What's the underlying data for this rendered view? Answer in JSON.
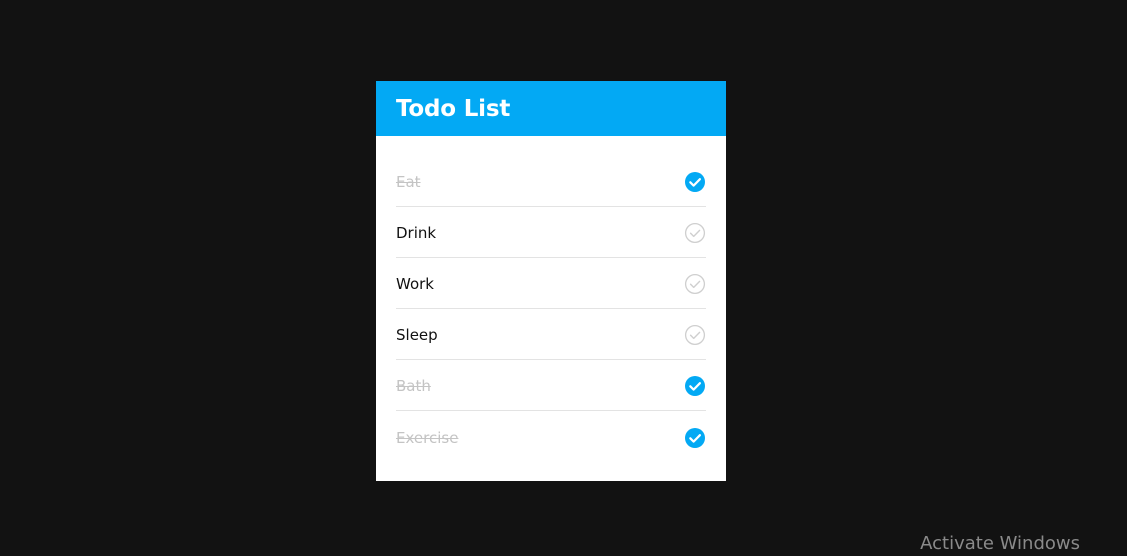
{
  "todo": {
    "title": "Todo List",
    "accent_color": "#03a9f4",
    "items": [
      {
        "label": "Eat",
        "done": true,
        "icon": "check-circle-filled-icon"
      },
      {
        "label": "Drink",
        "done": false,
        "icon": "check-circle-outline-icon"
      },
      {
        "label": "Work",
        "done": false,
        "icon": "check-circle-outline-icon"
      },
      {
        "label": "Sleep",
        "done": false,
        "icon": "check-circle-outline-icon"
      },
      {
        "label": "Bath",
        "done": true,
        "icon": "check-circle-filled-icon"
      },
      {
        "label": "Exercise",
        "done": true,
        "icon": "check-circle-filled-icon"
      }
    ]
  },
  "watermark": {
    "text": "Activate Windows"
  }
}
